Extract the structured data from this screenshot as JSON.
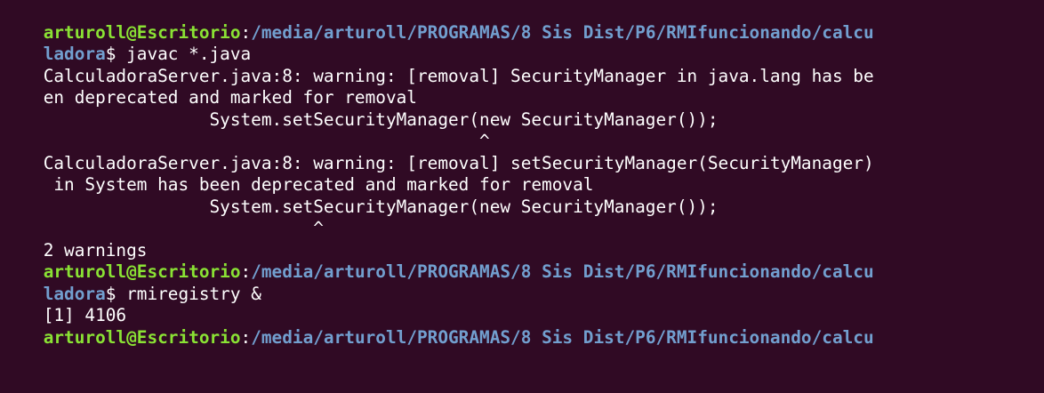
{
  "terminal": {
    "lines": [
      [
        {
          "style": "user",
          "text": "arturoll@Escritorio"
        },
        {
          "style": "plain",
          "text": ":"
        },
        {
          "style": "path",
          "text": "/media/arturoll/PROGRAMAS/8 Sis Dist/P6/RMIfuncionando/calcu"
        }
      ],
      [
        {
          "style": "path",
          "text": "ladora"
        },
        {
          "style": "plain",
          "text": "$ javac *.java"
        }
      ],
      [
        {
          "style": "plain",
          "text": "CalculadoraServer.java:8: warning: [removal] SecurityManager in java.lang has be"
        }
      ],
      [
        {
          "style": "plain",
          "text": "en deprecated and marked for removal"
        }
      ],
      [
        {
          "style": "plain",
          "text": "                System.setSecurityManager(new SecurityManager());"
        }
      ],
      [
        {
          "style": "plain",
          "text": "                                          ^"
        }
      ],
      [
        {
          "style": "plain",
          "text": "CalculadoraServer.java:8: warning: [removal] setSecurityManager(SecurityManager)"
        }
      ],
      [
        {
          "style": "plain",
          "text": " in System has been deprecated and marked for removal"
        }
      ],
      [
        {
          "style": "plain",
          "text": "                System.setSecurityManager(new SecurityManager());"
        }
      ],
      [
        {
          "style": "plain",
          "text": "                          ^"
        }
      ],
      [
        {
          "style": "plain",
          "text": "2 warnings"
        }
      ],
      [
        {
          "style": "user",
          "text": "arturoll@Escritorio"
        },
        {
          "style": "plain",
          "text": ":"
        },
        {
          "style": "path",
          "text": "/media/arturoll/PROGRAMAS/8 Sis Dist/P6/RMIfuncionando/calcu"
        }
      ],
      [
        {
          "style": "path",
          "text": "ladora"
        },
        {
          "style": "plain",
          "text": "$ rmiregistry &"
        }
      ],
      [
        {
          "style": "plain",
          "text": "[1] 4106"
        }
      ],
      [
        {
          "style": "user",
          "text": "arturoll@Escritorio"
        },
        {
          "style": "plain",
          "text": ":"
        },
        {
          "style": "path",
          "text": "/media/arturoll/PROGRAMAS/8 Sis Dist/P6/RMIfuncionando/calcu"
        }
      ]
    ]
  }
}
